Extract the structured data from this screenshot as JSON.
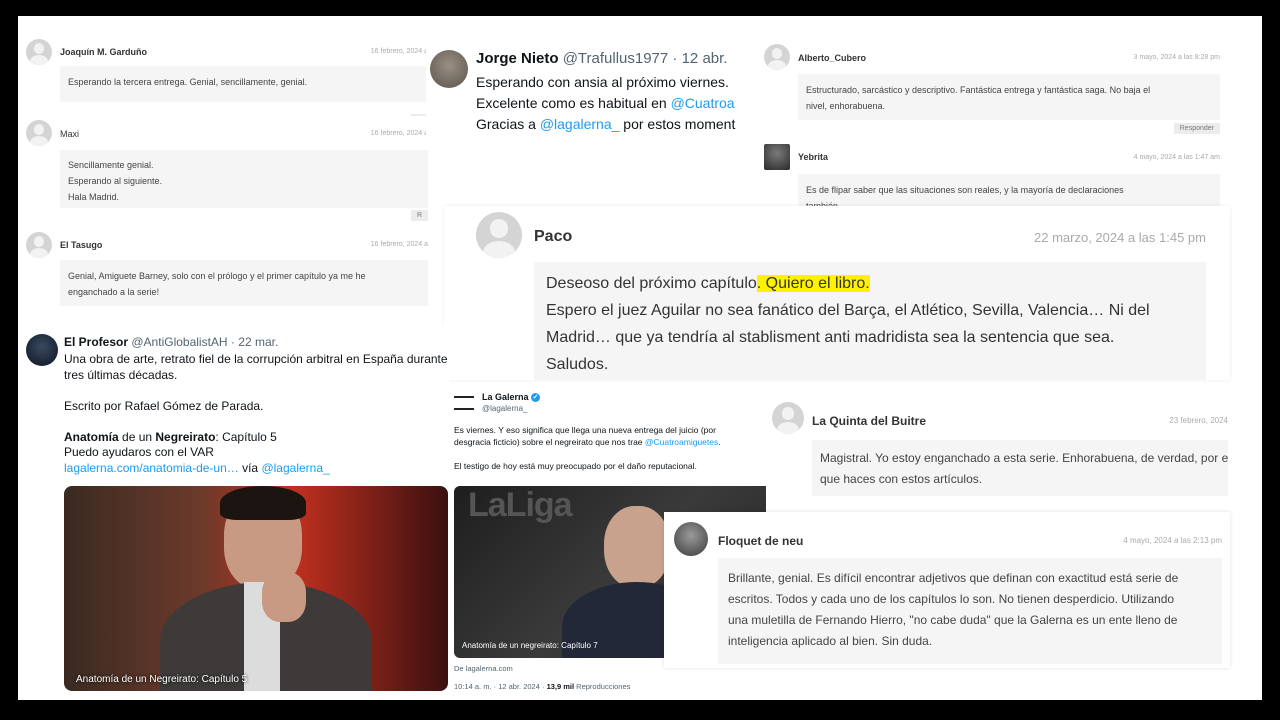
{
  "comment_joaquin": {
    "name": "Joaquín M. Garduño",
    "date": "16 febrero, 2024 a",
    "text": "Esperando la tercera entrega. Genial, sencillamente, genial.",
    "reply": "R"
  },
  "comment_maxi": {
    "name": "Maxi",
    "date": "16 febrero, 2024 a",
    "lines": [
      "Sencillamente genial.",
      "Esperando al siguiente.",
      "Hala Madrid."
    ],
    "reply": "R"
  },
  "comment_tasugo": {
    "name": "El Tasugo",
    "date": "16 febrero, 2024 a",
    "lines": [
      "Genial, Amiguete Barney, solo con el prólogo y el primer capítulo ya me he",
      "enganchado a la serie!"
    ]
  },
  "tweet_jorge": {
    "name": "Jorge Nieto",
    "handle": "@Trafullus1977",
    "sep": " · ",
    "date": "12 abr.",
    "line1": "Esperando con ansia al próximo viernes.",
    "line2_text": "Excelente como es habitual en ",
    "line2_link": "@Cuatroa",
    "line3_text": "Gracias a ",
    "line3_link": "@lagalerna_",
    "line3_tail": " por estos moment"
  },
  "comment_alberto": {
    "name": "Alberto_Cubero",
    "date": "3 mayo, 2024 a las 8:28 pm",
    "lines": [
      "Estructurado, sarcástico y descriptivo. Fantástica entrega y fantástica saga. No baja el",
      "nivel, enhorabuena."
    ],
    "reply": "Responder"
  },
  "comment_yebrita": {
    "name": "Yebrita",
    "date": "4 mayo, 2024 a las 1:47 am",
    "lines": [
      "Es de flipar saber que las situaciones son reales, y la mayoría de declaraciones",
      "también."
    ]
  },
  "comment_paco": {
    "name": "Paco",
    "date": "22 marzo, 2024 a las 1:45 pm",
    "line1_a": "Deseoso del próximo capítulo",
    "line1_b": ". Quiero el libro.",
    "line2": "Espero el juez Aguilar no sea fanático del Barça, el Atlético, Sevilla, Valencia… Ni del",
    "line3": "Madrid… que ya tendría al stablisment anti madridista sea la sentencia que sea.",
    "line4": "Saludos."
  },
  "tweet_profesor": {
    "name": "El Profesor",
    "handle": "@AntiGlobalistAH",
    "sep": " · ",
    "date": "22 mar.",
    "line1": "Una obra de arte, retrato fiel de la corrupción arbitral en España durante",
    "line2": "tres últimas décadas.",
    "line3": "Escrito por Rafael Gómez de Parada.",
    "line4_bold1": "Anatomía",
    "line4_mid": " de un ",
    "line4_bold2": "Negreirato",
    "line4_tail": ": Capítulo 5",
    "line5": "Puedo ayudaros con el VAR",
    "line6_link": "lagalerna.com/anatomia-de-un…",
    "line6_via": " vía ",
    "line6_handle": "@lagalerna_",
    "image_caption": "Anatomía de un Negreirato: Capítulo 5"
  },
  "tweet_galerna": {
    "name": "La Galerna",
    "handle": "@lagalerna_",
    "line1": "Es viernes. Y eso significa que llega una nueva entrega del juicio (por",
    "line2_text": "desgracia ficticio) sobre el negreirato que nos trae ",
    "line2_link": "@Cuatroamiguetes",
    "line2_tail": ".",
    "line3": "El testigo de hoy está muy preocupado por el daño reputacional.",
    "image_logo": "LaLiga",
    "image_caption": "Anatomía de un negreirato: Capítulo 7",
    "source": "De lagalerna.com",
    "meta_time": "10:14 a. m. · 12 abr. 2024 · ",
    "views": "13,9 mil",
    "views_label": " Reproducciones"
  },
  "comment_quinta": {
    "name": "La Quinta del Buitre",
    "date": "23 febrero, 2024",
    "lines": [
      "Magistral. Yo estoy enganchado a esta serie. Enhorabuena, de verdad, por el tr",
      "que haces con estos artículos."
    ]
  },
  "comment_floquet": {
    "name": "Floquet de neu",
    "date": "4 mayo, 2024 a las 2:13 pm",
    "lines": [
      "Brillante, genial. Es difícil encontrar adjetivos que definan con exactitud está serie de",
      "escritos. Todos y cada uno de los capítulos lo son. No tienen desperdicio. Utilizando",
      "una muletilla de Fernando Hierro, \"no cabe duda\" que la Galerna es un ente lleno de",
      "inteligencia aplicado al bien. Sin duda."
    ]
  }
}
